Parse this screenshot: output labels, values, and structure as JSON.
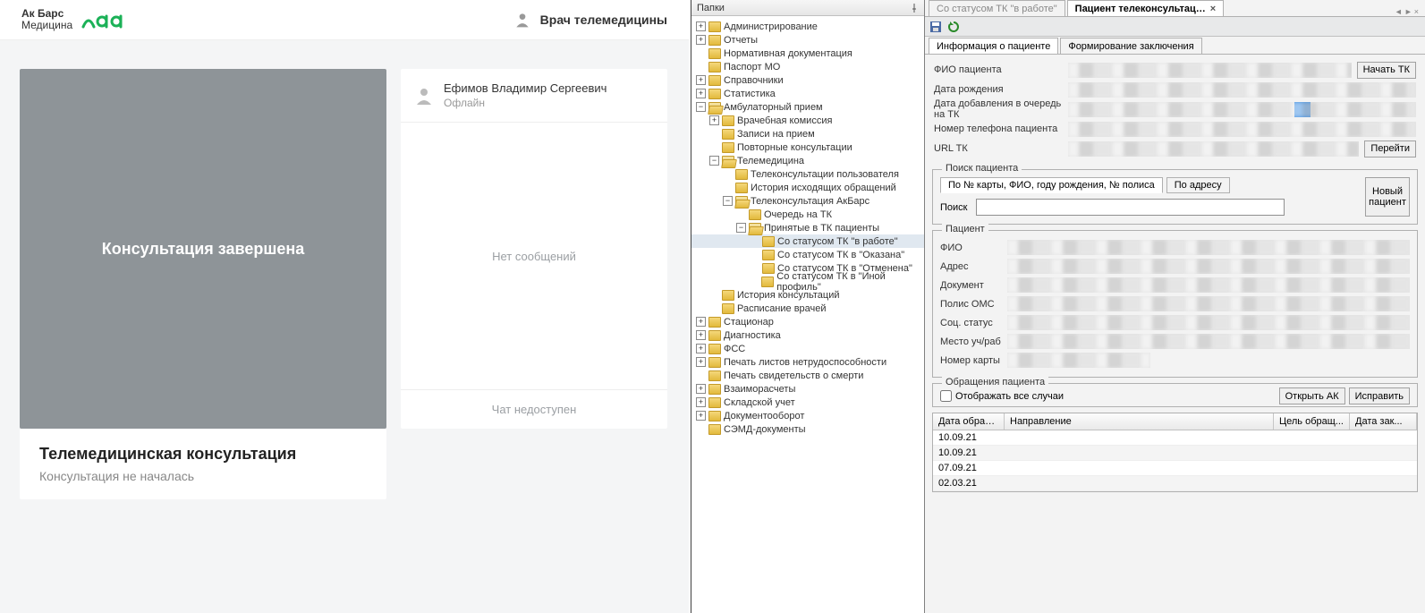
{
  "webapp": {
    "brand_line1": "Ак Барс",
    "brand_line2": "Медицина",
    "doctor_label": "Врач телемедицины",
    "video_overlay": "Консультация завершена",
    "consult_title": "Телемедицинская консультация",
    "consult_sub": "Консультация не началась",
    "chat_name": "Ефимов Владимир Сергеевич",
    "chat_status": "Офлайн",
    "chat_empty": "Нет сообщений",
    "chat_footer": "Чат недоступен"
  },
  "nav": {
    "title": "Папки",
    "items": [
      {
        "lvl": 1,
        "exp": "+",
        "label": "Администрирование"
      },
      {
        "lvl": 1,
        "exp": "+",
        "label": "Отчеты"
      },
      {
        "lvl": 1,
        "exp": "",
        "label": "Нормативная документация"
      },
      {
        "lvl": 1,
        "exp": "",
        "label": "Паспорт МО"
      },
      {
        "lvl": 1,
        "exp": "+",
        "label": "Справочники"
      },
      {
        "lvl": 1,
        "exp": "+",
        "label": "Статистика"
      },
      {
        "lvl": 1,
        "exp": "-",
        "label": "Амбулаторный прием",
        "open": true
      },
      {
        "lvl": 2,
        "exp": "+",
        "label": "Врачебная комиссия"
      },
      {
        "lvl": 2,
        "exp": "",
        "label": "Записи на прием"
      },
      {
        "lvl": 2,
        "exp": "",
        "label": "Повторные консультации"
      },
      {
        "lvl": 2,
        "exp": "-",
        "label": "Телемедицина",
        "open": true
      },
      {
        "lvl": 3,
        "exp": "",
        "label": "Телеконсультации пользователя"
      },
      {
        "lvl": 3,
        "exp": "",
        "label": "История исходящих обращений"
      },
      {
        "lvl": 3,
        "exp": "-",
        "label": "Телеконсультация АкБарс",
        "open": true
      },
      {
        "lvl": 4,
        "exp": "",
        "label": "Очередь на ТК"
      },
      {
        "lvl": 4,
        "exp": "-",
        "label": "Принятые в ТК пациенты",
        "open": true
      },
      {
        "lvl": 5,
        "exp": "",
        "label": "Со статусом ТК \"в работе\"",
        "selected": true
      },
      {
        "lvl": 5,
        "exp": "",
        "label": "Со статусом ТК в \"Оказана\""
      },
      {
        "lvl": 5,
        "exp": "",
        "label": "Со статусом ТК в \"Отменена\""
      },
      {
        "lvl": 5,
        "exp": "",
        "label": "Со статусом ТК в \"Иной профиль\""
      },
      {
        "lvl": 2,
        "exp": "",
        "label": "История консультаций"
      },
      {
        "lvl": 2,
        "exp": "",
        "label": "Расписание врачей"
      },
      {
        "lvl": 1,
        "exp": "+",
        "label": "Стационар"
      },
      {
        "lvl": 1,
        "exp": "+",
        "label": "Диагностика"
      },
      {
        "lvl": 1,
        "exp": "+",
        "label": "ФСС"
      },
      {
        "lvl": 1,
        "exp": "+",
        "label": "Печать листов нетрудоспособности"
      },
      {
        "lvl": 1,
        "exp": "",
        "label": "Печать свидетельств о смерти"
      },
      {
        "lvl": 1,
        "exp": "+",
        "label": "Взаиморасчеты"
      },
      {
        "lvl": 1,
        "exp": "+",
        "label": "Складской учет"
      },
      {
        "lvl": 1,
        "exp": "+",
        "label": "Документооборот"
      },
      {
        "lvl": 1,
        "exp": "",
        "label": "СЭМД-документы"
      }
    ]
  },
  "detail": {
    "doc_tabs": {
      "inactive": "Со статусом ТК \"в работе\"",
      "active": "Пациент телеконсультац…"
    },
    "sub_tabs": {
      "info": "Информация о пациенте",
      "concl": "Формирование заключения"
    },
    "info_labels": {
      "fio": "ФИО пациента",
      "dob": "Дата рождения",
      "queue": "Дата добавления в очередь на ТК",
      "phone": "Номер телефона пациента",
      "url": "URL ТК"
    },
    "buttons": {
      "start_tk": "Начать ТК",
      "go": "Перейти",
      "new_patient": "Новый\nпациент",
      "open_ak": "Открыть АК",
      "fix": "Исправить"
    },
    "search": {
      "legend": "Поиск пациента",
      "tab_card": "По № карты, ФИО, году рождения, № полиса",
      "tab_addr": "По адресу",
      "label": "Поиск"
    },
    "patient": {
      "legend": "Пациент",
      "labels": {
        "fio": "ФИО",
        "addr": "Адрес",
        "doc": "Документ",
        "oms": "Полис ОМС",
        "soc": "Соц. статус",
        "work": "Место уч/раб",
        "card": "Номер карты"
      }
    },
    "appeals": {
      "legend": "Обращения пациента",
      "show_all": "Отображать все случаи",
      "columns": {
        "date": "Дата обращ...",
        "dir": "Направление",
        "goal": "Цель обращ...",
        "close": "Дата зак..."
      },
      "rows": [
        {
          "date": "10.09.21"
        },
        {
          "date": "10.09.21"
        },
        {
          "date": "07.09.21"
        },
        {
          "date": "02.03.21"
        }
      ]
    }
  }
}
